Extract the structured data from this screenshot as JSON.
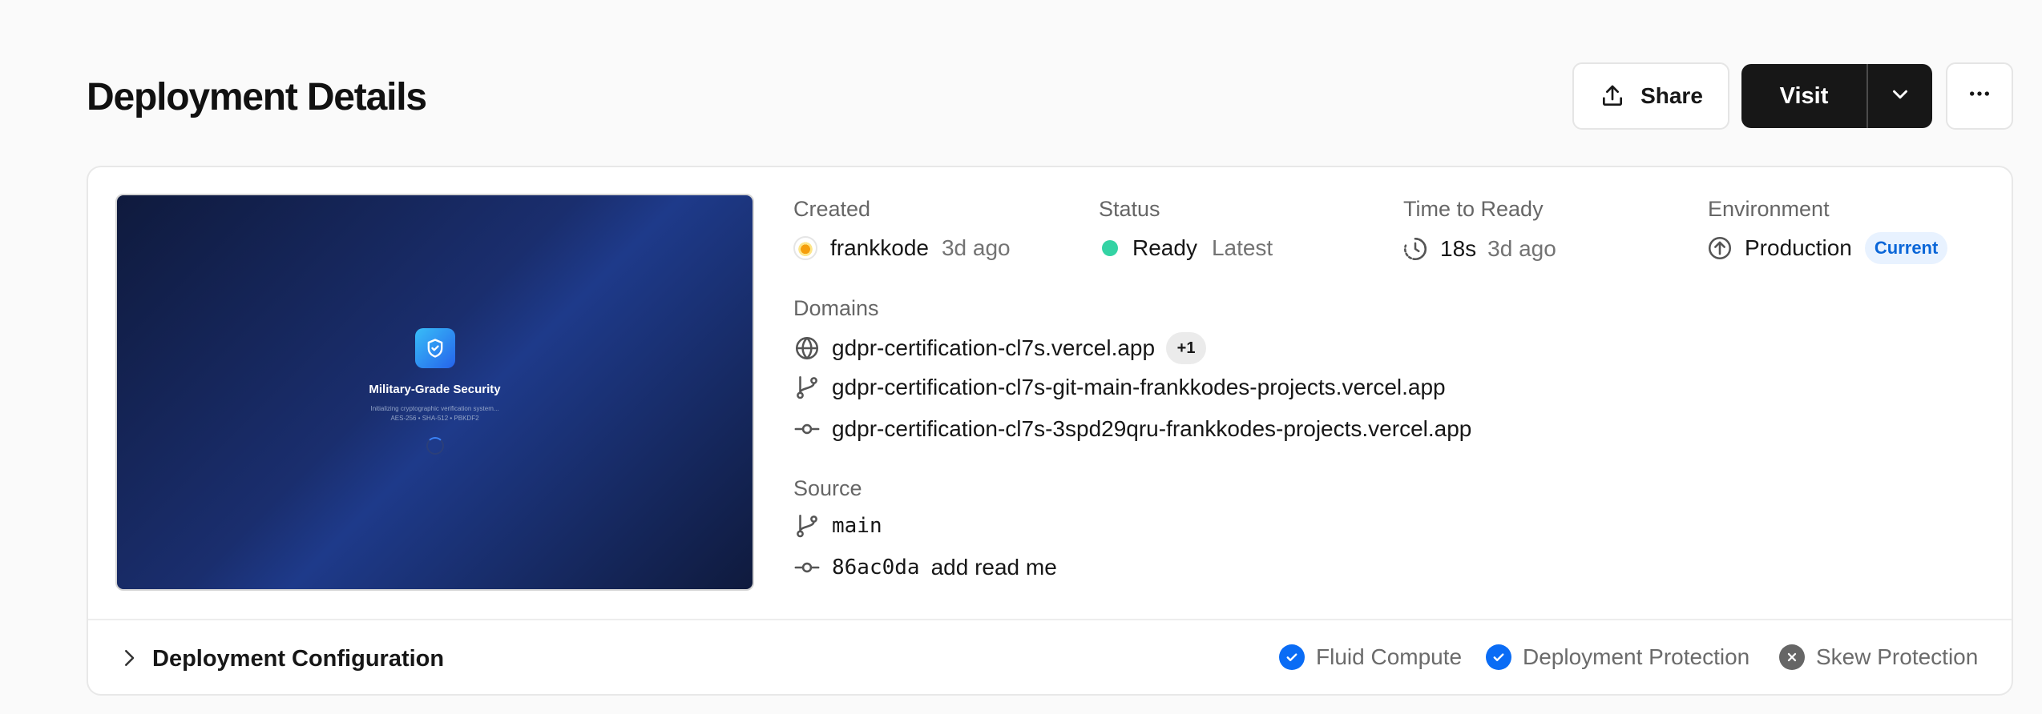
{
  "header": {
    "title": "Deployment Details",
    "share_label": "Share",
    "visit_label": "Visit"
  },
  "preview": {
    "title": "Military-Grade Security",
    "subtitle": "Initializing cryptographic verification system...",
    "specs": "AES-256 • SHA-512 • PBKDF2"
  },
  "created": {
    "label": "Created",
    "user": "frankkode",
    "time": "3d ago"
  },
  "status": {
    "label": "Status",
    "value": "Ready",
    "tag": "Latest",
    "color": "#34d3a4"
  },
  "time_to_ready": {
    "label": "Time to Ready",
    "value": "18s",
    "time": "3d ago"
  },
  "environment": {
    "label": "Environment",
    "value": "Production",
    "badge": "Current"
  },
  "domains": {
    "label": "Domains",
    "primary": "gdpr-certification-cl7s.vercel.app",
    "extra_count": "+1",
    "branch": "gdpr-certification-cl7s-git-main-frankkodes-projects.vercel.app",
    "commit": "gdpr-certification-cl7s-3spd29qru-frankkodes-projects.vercel.app"
  },
  "source": {
    "label": "Source",
    "branch": "main",
    "commit_hash": "86ac0da",
    "commit_message": "add read me"
  },
  "configuration": {
    "title": "Deployment Configuration",
    "features": [
      {
        "label": "Fluid Compute",
        "enabled": true
      },
      {
        "label": "Deployment Protection",
        "enabled": true
      },
      {
        "label": "Skew Protection",
        "enabled": false
      }
    ]
  },
  "colors": {
    "accent": "#0a6cf5",
    "primary_button": "#171717"
  }
}
